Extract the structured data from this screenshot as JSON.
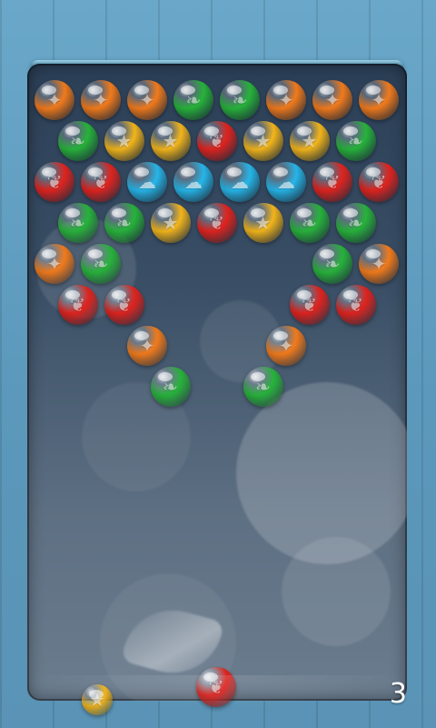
{
  "colors": {
    "orange": "#f27a1b",
    "green": "#27b33a",
    "yellow": "#f3b51a",
    "red": "#e0231e",
    "blue": "#26b6e9"
  },
  "symbols": {
    "orange": "✦",
    "green": "❧",
    "yellow": "★",
    "red": "❦",
    "blue": "☁"
  },
  "board": {
    "rows": [
      [
        "orange",
        "orange",
        "orange",
        "green",
        "green",
        "orange",
        "orange",
        "orange"
      ],
      [
        "green",
        "yellow",
        "yellow",
        "red",
        "yellow",
        "yellow",
        "green"
      ],
      [
        "red",
        "red",
        "blue",
        "blue",
        "blue",
        "blue",
        "red",
        "red"
      ],
      [
        "green",
        "green",
        "yellow",
        "red",
        "yellow",
        "green",
        "green"
      ],
      [
        "orange",
        "green",
        null,
        null,
        null,
        null,
        "green",
        "orange"
      ],
      [
        "red",
        "red",
        null,
        null,
        null,
        "red",
        "red"
      ],
      [
        null,
        null,
        "orange",
        null,
        null,
        "orange",
        null,
        null
      ],
      [
        null,
        null,
        "green",
        null,
        "green",
        null,
        null
      ]
    ]
  },
  "shooter": {
    "color": "red"
  },
  "next": {
    "color": "yellow"
  },
  "hud": {
    "remaining_shots": "3"
  }
}
